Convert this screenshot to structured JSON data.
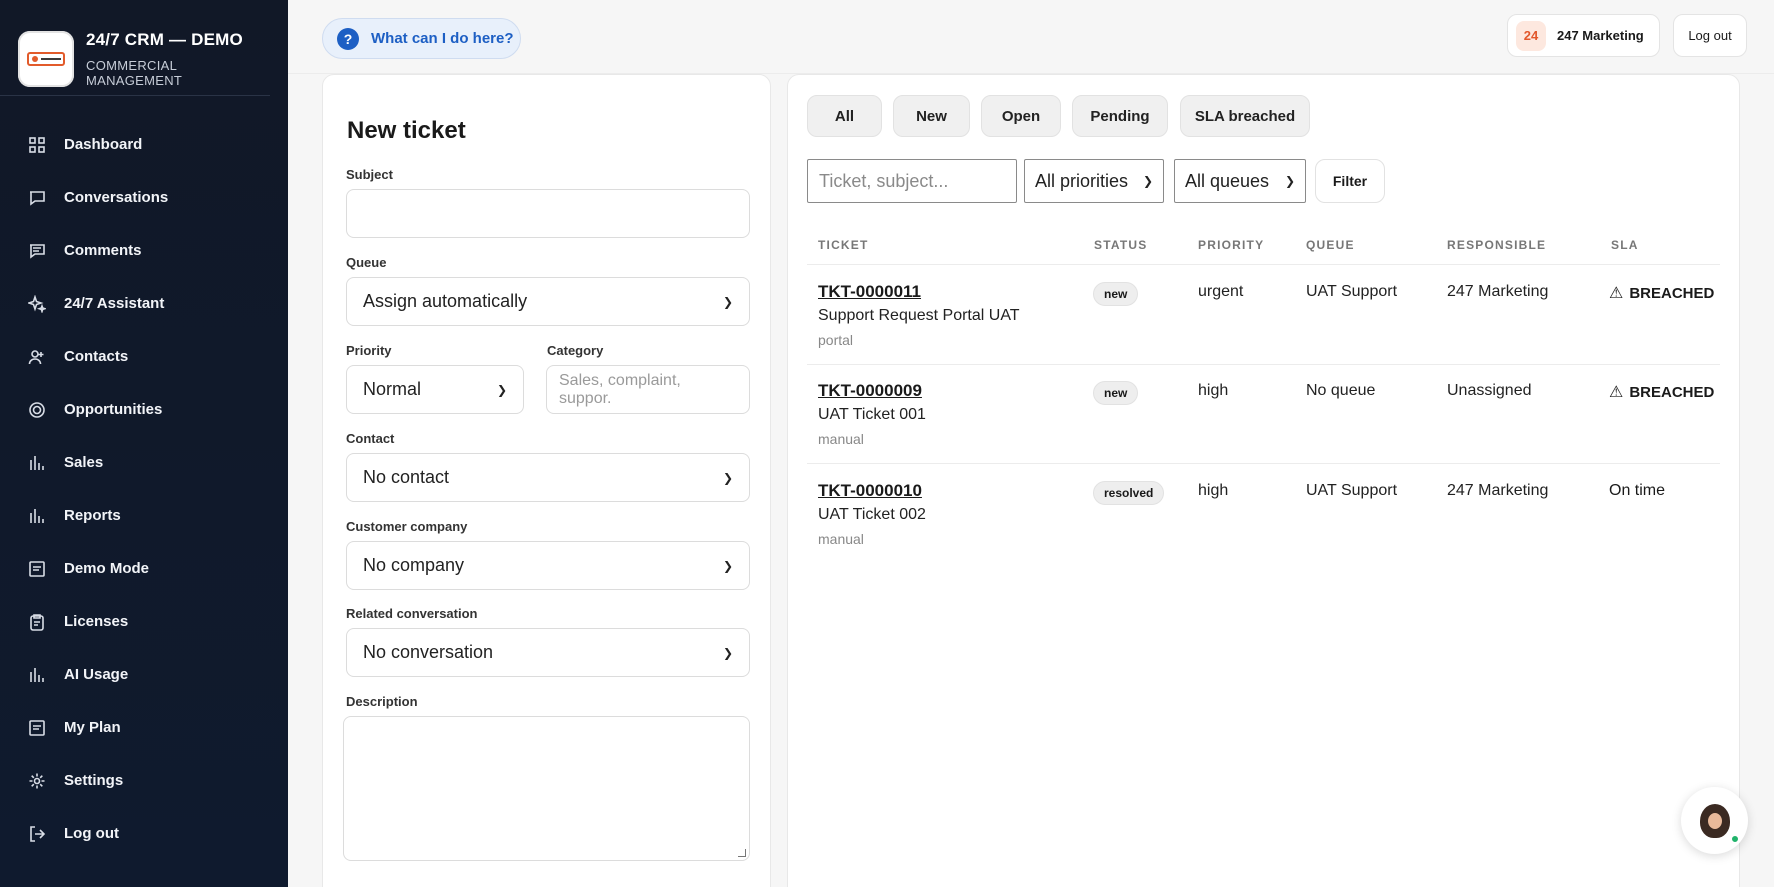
{
  "brand": {
    "title": "24/7 CRM — DEMO",
    "subtitle": "COMMERCIAL MANAGEMENT"
  },
  "nav": [
    {
      "label": "Dashboard",
      "icon": "grid-icon"
    },
    {
      "label": "Conversations",
      "icon": "chat-icon"
    },
    {
      "label": "Comments",
      "icon": "comment-icon"
    },
    {
      "label": "24/7 Assistant",
      "icon": "sparkle-icon"
    },
    {
      "label": "Contacts",
      "icon": "users-icon"
    },
    {
      "label": "Opportunities",
      "icon": "target-icon"
    },
    {
      "label": "Sales",
      "icon": "bar-chart-icon"
    },
    {
      "label": "Reports",
      "icon": "bar-chart-icon"
    },
    {
      "label": "Demo Mode",
      "icon": "window-icon"
    },
    {
      "label": "Licenses",
      "icon": "clipboard-icon"
    },
    {
      "label": "AI Usage",
      "icon": "bar-chart-icon"
    },
    {
      "label": "My Plan",
      "icon": "window-icon"
    },
    {
      "label": "Settings",
      "icon": "gear-icon"
    },
    {
      "label": "Log out",
      "icon": "logout-icon"
    }
  ],
  "topbar": {
    "help_label": "What can I do here?",
    "user_badge": "24",
    "user_name": "247 Marketing",
    "logout_label": "Log out"
  },
  "form": {
    "title": "New ticket",
    "subject_label": "Subject",
    "subject_value": "",
    "queue_label": "Queue",
    "queue_value": "Assign automatically",
    "priority_label": "Priority",
    "priority_value": "Normal",
    "category_label": "Category",
    "category_placeholder": "Sales, complaint, suppor.",
    "contact_label": "Contact",
    "contact_value": "No contact",
    "company_label": "Customer company",
    "company_value": "No company",
    "conversation_label": "Related conversation",
    "conversation_value": "No conversation",
    "description_label": "Description"
  },
  "tabs": [
    "All",
    "New",
    "Open",
    "Pending",
    "SLA breached"
  ],
  "filters": {
    "search_placeholder": "Ticket, subject...",
    "priority_value": "All priorities",
    "queue_value": "All queues",
    "filter_label": "Filter"
  },
  "table": {
    "headers": [
      "TICKET",
      "STATUS",
      "PRIORITY",
      "QUEUE",
      "RESPONSIBLE",
      "SLA"
    ],
    "rows": [
      {
        "id": "TKT-0000011",
        "subject": "Support Request Portal UAT",
        "source": "portal",
        "status": "new",
        "priority": "urgent",
        "queue": "UAT Support",
        "responsible": "247 Marketing",
        "sla": "BREACHED"
      },
      {
        "id": "TKT-0000009",
        "subject": "UAT Ticket 001",
        "source": "manual",
        "status": "new",
        "priority": "high",
        "queue": "No queue",
        "responsible": "Unassigned",
        "sla": "BREACHED"
      },
      {
        "id": "TKT-0000010",
        "subject": "UAT Ticket 002",
        "source": "manual",
        "status": "resolved",
        "priority": "high",
        "queue": "UAT Support",
        "responsible": "247 Marketing",
        "sla": "On time"
      }
    ]
  },
  "colors": {
    "sidebar": "#111827",
    "accent": "#1d5fc4",
    "badge": "#e2572b"
  }
}
